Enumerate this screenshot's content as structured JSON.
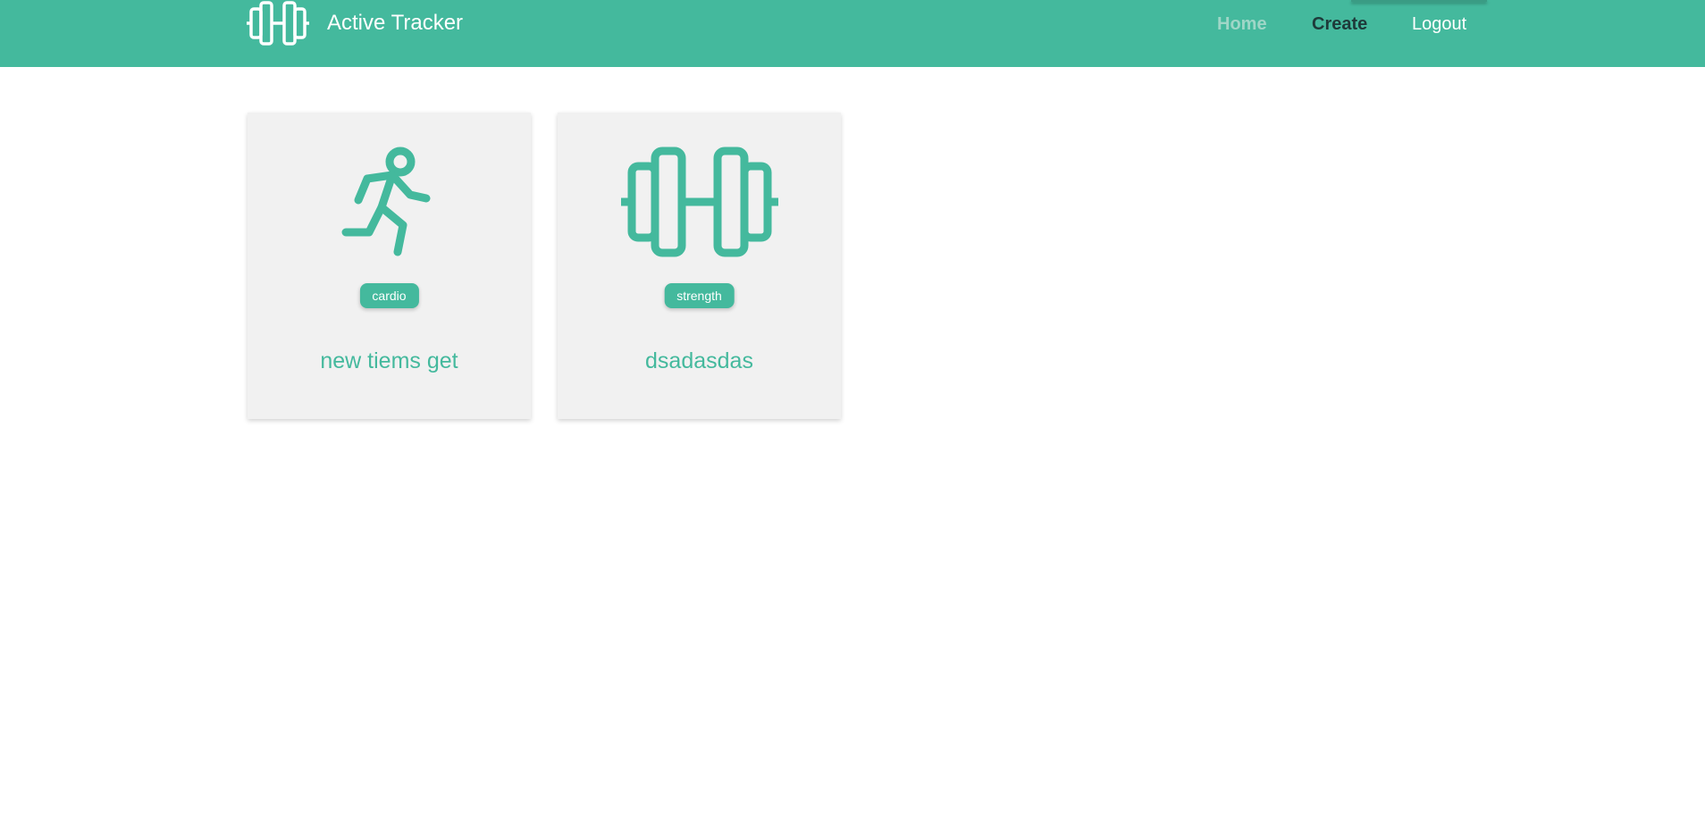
{
  "header": {
    "brand_title": "Active Tracker",
    "brand_icon": "dumbbell-icon",
    "nav": [
      {
        "label": "Home"
      },
      {
        "label": "Create"
      },
      {
        "label": "Logout"
      }
    ]
  },
  "cards": [
    {
      "icon": "running-person-icon",
      "category": "cardio",
      "title": "new tiems get"
    },
    {
      "icon": "dumbbell-icon",
      "category": "strength",
      "title": "dsadasdas"
    }
  ],
  "colors": {
    "accent": "#44b99d",
    "card_bg": "#f1f1f1",
    "nav_active": "#1e3a3a",
    "nav_muted": "#9fd6c7"
  }
}
